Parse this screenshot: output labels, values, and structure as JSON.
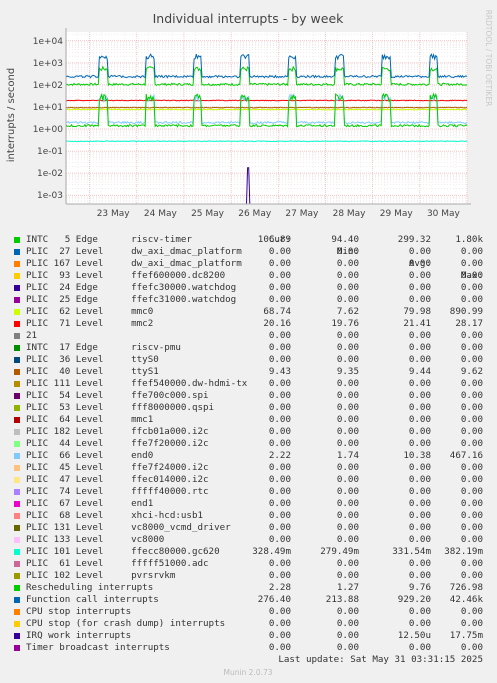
{
  "chart_data": {
    "type": "line",
    "title": "Individual interrupts - by week",
    "ylabel": "interrupts / second",
    "yscale": "log",
    "ylim": [
      0.0004,
      25000
    ],
    "y_ticks": [
      "1e-03",
      "1e-02",
      "1e-01",
      "1e+00",
      "1e+01",
      "1e+02",
      "1e+03",
      "1e+04"
    ],
    "x_ticks": [
      "23 May",
      "24 May",
      "25 May",
      "26 May",
      "27 May",
      "28 May",
      "29 May",
      "30 May"
    ],
    "grid": true,
    "side_label": "RRDTOOL / TOBI OETIKER",
    "headers": {
      "cur": "Cur:",
      "min": "Min:",
      "avg": "Avg:",
      "max": "Max:"
    },
    "series": [
      {
        "name": "INTC   5 Edge      riscv-timer",
        "color": "#00cc00",
        "cur": "106.89",
        "min": "94.40",
        "avg": "299.32",
        "max": "1.80k"
      },
      {
        "name": "PLIC  27 Level     dw_axi_dmac_platform",
        "color": "#0066b3",
        "cur": "0.00",
        "min": "0.00",
        "avg": "0.00",
        "max": "0.00"
      },
      {
        "name": "PLIC 167 Level     dw_axi_dmac_platform",
        "color": "#ff8000",
        "cur": "0.00",
        "min": "0.00",
        "avg": "0.00",
        "max": "0.00"
      },
      {
        "name": "PLIC  93 Level     ffef600000.dc8200",
        "color": "#ffcc00",
        "cur": "0.00",
        "min": "0.00",
        "avg": "0.00",
        "max": "0.00"
      },
      {
        "name": "PLIC  24 Edge      ffefc30000.watchdog",
        "color": "#330099",
        "cur": "0.00",
        "min": "0.00",
        "avg": "0.00",
        "max": "0.00"
      },
      {
        "name": "PLIC  25 Edge      ffefc31000.watchdog",
        "color": "#990099",
        "cur": "0.00",
        "min": "0.00",
        "avg": "0.00",
        "max": "0.00"
      },
      {
        "name": "PLIC  62 Level     mmc0",
        "color": "#ccff00",
        "cur": "68.74",
        "min": "7.62",
        "avg": "79.98",
        "max": "890.99"
      },
      {
        "name": "PLIC  71 Level     mmc2",
        "color": "#ff0000",
        "cur": "20.16",
        "min": "19.76",
        "avg": "21.41",
        "max": "28.17"
      },
      {
        "name": "21",
        "color": "#808080",
        "cur": "0.00",
        "min": "0.00",
        "avg": "0.00",
        "max": "0.00"
      },
      {
        "name": "INTC  17 Edge      riscv-pmu",
        "color": "#008f00",
        "cur": "0.00",
        "min": "0.00",
        "avg": "0.00",
        "max": "0.00"
      },
      {
        "name": "PLIC  36 Level     ttyS0",
        "color": "#00487d",
        "cur": "0.00",
        "min": "0.00",
        "avg": "0.00",
        "max": "0.00"
      },
      {
        "name": "PLIC  40 Level     ttyS1",
        "color": "#b35a00",
        "cur": "9.43",
        "min": "9.35",
        "avg": "9.44",
        "max": "9.62"
      },
      {
        "name": "PLIC 111 Level     ffef540000.dw-hdmi-tx",
        "color": "#b38f00",
        "cur": "0.00",
        "min": "0.00",
        "avg": "0.00",
        "max": "0.00"
      },
      {
        "name": "PLIC  54 Level     ffe700c000.spi",
        "color": "#6b006b",
        "cur": "0.00",
        "min": "0.00",
        "avg": "0.00",
        "max": "0.00"
      },
      {
        "name": "PLIC  53 Level     fff8000000.qspi",
        "color": "#8fb300",
        "cur": "0.00",
        "min": "0.00",
        "avg": "0.00",
        "max": "0.00"
      },
      {
        "name": "PLIC  64 Level     mmc1",
        "color": "#b30000",
        "cur": "0.00",
        "min": "0.00",
        "avg": "0.00",
        "max": "0.00"
      },
      {
        "name": "PLIC 182 Level     ffcb01a000.i2c",
        "color": "#bebebe",
        "cur": "0.00",
        "min": "0.00",
        "avg": "0.00",
        "max": "0.00"
      },
      {
        "name": "PLIC  44 Level     ffe7f20000.i2c",
        "color": "#80ff80",
        "cur": "0.00",
        "min": "0.00",
        "avg": "0.00",
        "max": "0.00"
      },
      {
        "name": "PLIC  66 Level     end0",
        "color": "#80c9ff",
        "cur": "2.22",
        "min": "1.74",
        "avg": "10.38",
        "max": "467.16"
      },
      {
        "name": "PLIC  45 Level     ffe7f24000.i2c",
        "color": "#ffc080",
        "cur": "0.00",
        "min": "0.00",
        "avg": "0.00",
        "max": "0.00"
      },
      {
        "name": "PLIC  47 Level     ffec014000.i2c",
        "color": "#ffe680",
        "cur": "0.00",
        "min": "0.00",
        "avg": "0.00",
        "max": "0.00"
      },
      {
        "name": "PLIC  74 Level     fffff40000.rtc",
        "color": "#aa80ff",
        "cur": "0.00",
        "min": "0.00",
        "avg": "0.00",
        "max": "0.00"
      },
      {
        "name": "PLIC  67 Level     end1",
        "color": "#ee00cc",
        "cur": "0.00",
        "min": "0.00",
        "avg": "0.00",
        "max": "0.00"
      },
      {
        "name": "PLIC  68 Level     xhci-hcd:usb1",
        "color": "#ff8080",
        "cur": "0.00",
        "min": "0.00",
        "avg": "0.00",
        "max": "0.00"
      },
      {
        "name": "PLIC 131 Level     vc8000_vcmd_driver",
        "color": "#666600",
        "cur": "0.00",
        "min": "0.00",
        "avg": "0.00",
        "max": "0.00"
      },
      {
        "name": "PLIC 133 Level     vc8000",
        "color": "#ffbfff",
        "cur": "0.00",
        "min": "0.00",
        "avg": "0.00",
        "max": "0.00"
      },
      {
        "name": "PLIC 101 Level     ffecc80000.gc620",
        "color": "#00ffcc",
        "cur": "328.49m",
        "min": "279.49m",
        "avg": "331.54m",
        "max": "382.19m"
      },
      {
        "name": "PLIC  61 Level     fffff51000.adc",
        "color": "#cc6699",
        "cur": "0.00",
        "min": "0.00",
        "avg": "0.00",
        "max": "0.00"
      },
      {
        "name": "PLIC 102 Level     pvrsrvkm",
        "color": "#999900",
        "cur": "0.00",
        "min": "0.00",
        "avg": "0.00",
        "max": "0.00"
      },
      {
        "name": "Rescheduling interrupts",
        "color": "#00cc00",
        "cur": "2.28",
        "min": "1.27",
        "avg": "9.76",
        "max": "726.98"
      },
      {
        "name": "Function call interrupts",
        "color": "#0066b3",
        "cur": "276.40",
        "min": "213.88",
        "avg": "929.20",
        "max": "42.46k"
      },
      {
        "name": "CPU stop interrupts",
        "color": "#ff8000",
        "cur": "0.00",
        "min": "0.00",
        "avg": "0.00",
        "max": "0.00"
      },
      {
        "name": "CPU stop (for crash dump) interrupts",
        "color": "#ffcc00",
        "cur": "0.00",
        "min": "0.00",
        "avg": "0.00",
        "max": "0.00"
      },
      {
        "name": "IRQ work interrupts",
        "color": "#330099",
        "cur": "0.00",
        "min": "0.00",
        "avg": "12.50u",
        "max": "17.75m"
      },
      {
        "name": "Timer broadcast interrupts",
        "color": "#990099",
        "cur": "0.00",
        "min": "0.00",
        "avg": "0.00",
        "max": "0.00"
      }
    ]
  },
  "footer": {
    "last_update": "Last update: Sat May 31 03:31:15 2025",
    "generator": "Munin 2.0.73"
  }
}
